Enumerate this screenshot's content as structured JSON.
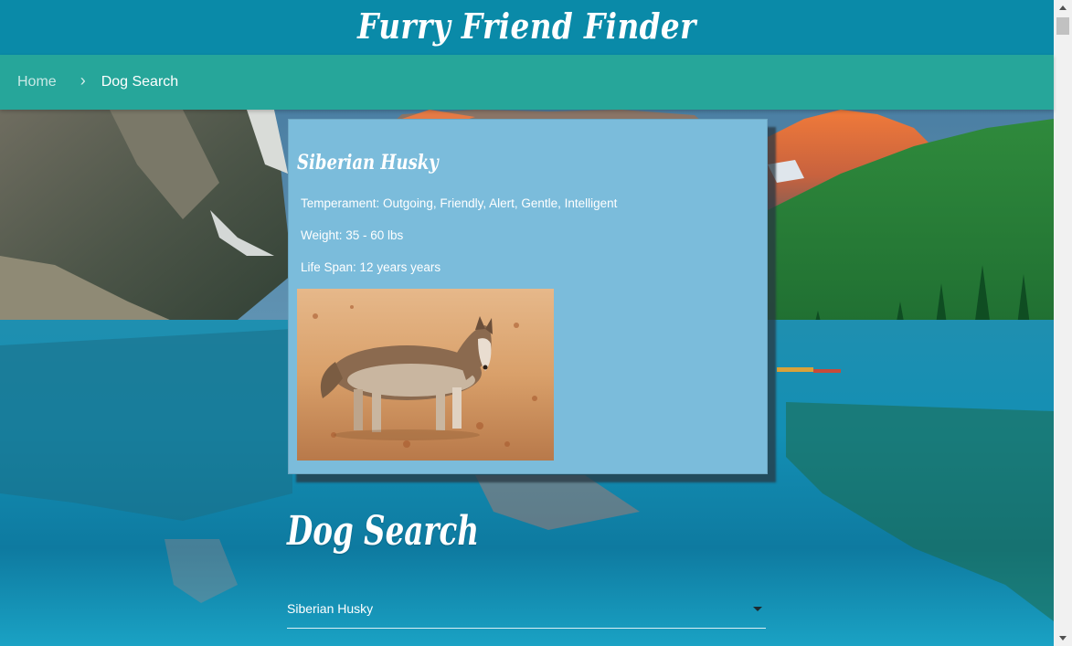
{
  "header": {
    "title": "Furry Friend Finder"
  },
  "breadcrumb": {
    "home": "Home",
    "current": "Dog Search"
  },
  "card": {
    "breed": "Siberian Husky",
    "temperament": "Temperament: Outgoing, Friendly, Alert, Gentle, Intelligent",
    "weight": "Weight: 35 - 60 lbs",
    "life_span": "Life Span: 12 years years"
  },
  "search": {
    "heading": "Dog Search",
    "selected_breed": "Siberian Husky"
  },
  "colors": {
    "header_bg": "#0a8aa8",
    "nav_bg": "#26a69a",
    "card_bg": "#7bbcdb"
  }
}
